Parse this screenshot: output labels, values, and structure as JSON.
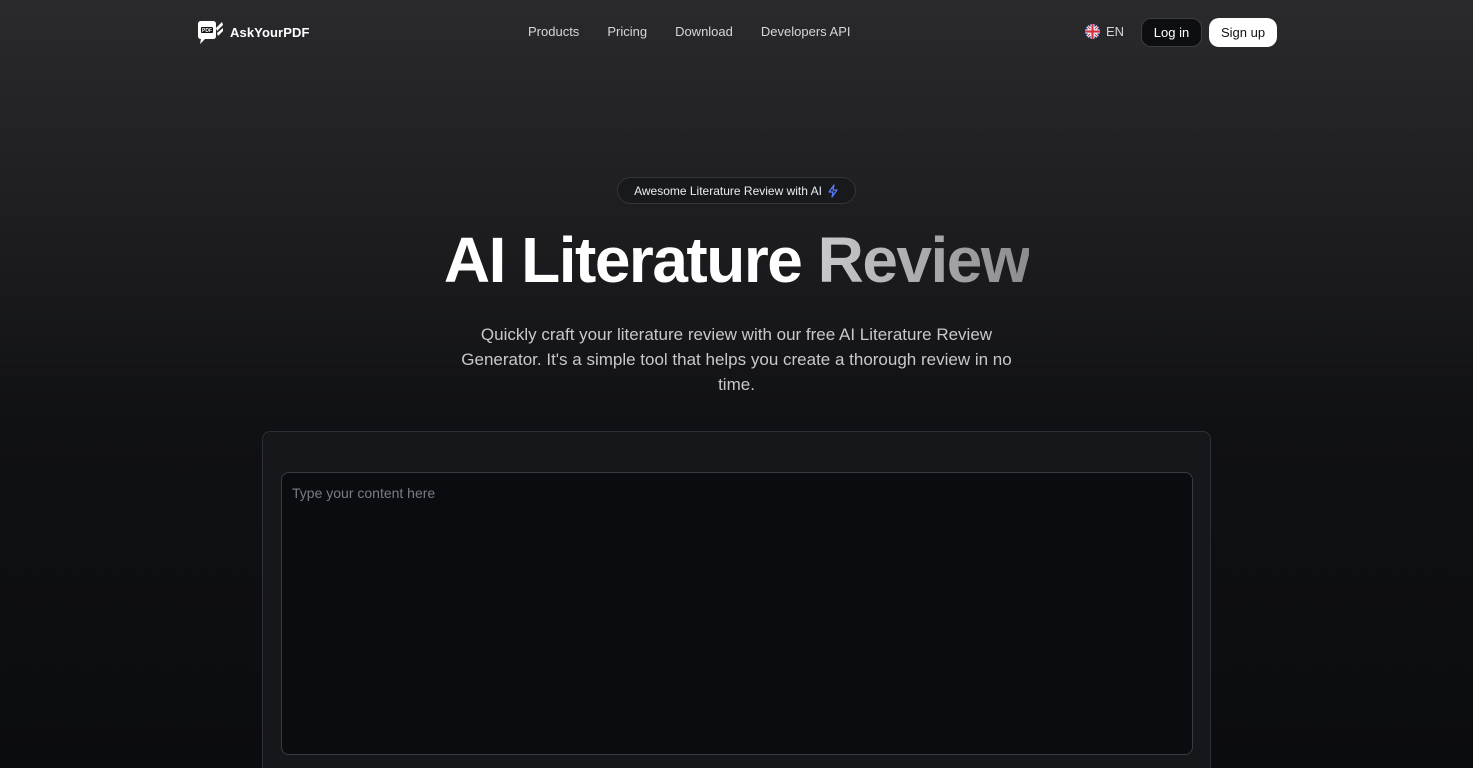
{
  "header": {
    "logo_text": "AskYourPDF",
    "nav": [
      {
        "label": "Products"
      },
      {
        "label": "Pricing"
      },
      {
        "label": "Download"
      },
      {
        "label": "Developers API"
      }
    ],
    "language": "EN",
    "login_label": "Log in",
    "signup_label": "Sign up"
  },
  "hero": {
    "badge": "Awesome Literature Review with AI",
    "title_part1": "AI Literature",
    "title_part2": "Review",
    "subtitle": "Quickly craft your literature review with our free AI Literature Review Generator. It's a simple tool that helps you create a thorough review in no time."
  },
  "editor": {
    "value": "",
    "placeholder": "Type your content here"
  },
  "icons": {
    "logo": "pdf-chat-bubble-icon",
    "language": "uk-flag-icon",
    "badge": "lightning-bolt-icon"
  },
  "colors": {
    "background_top": "#2a2a2c",
    "background_bottom": "#0b0c10",
    "badge_accent": "#5b7cff",
    "signup_bg": "#ffffff"
  }
}
